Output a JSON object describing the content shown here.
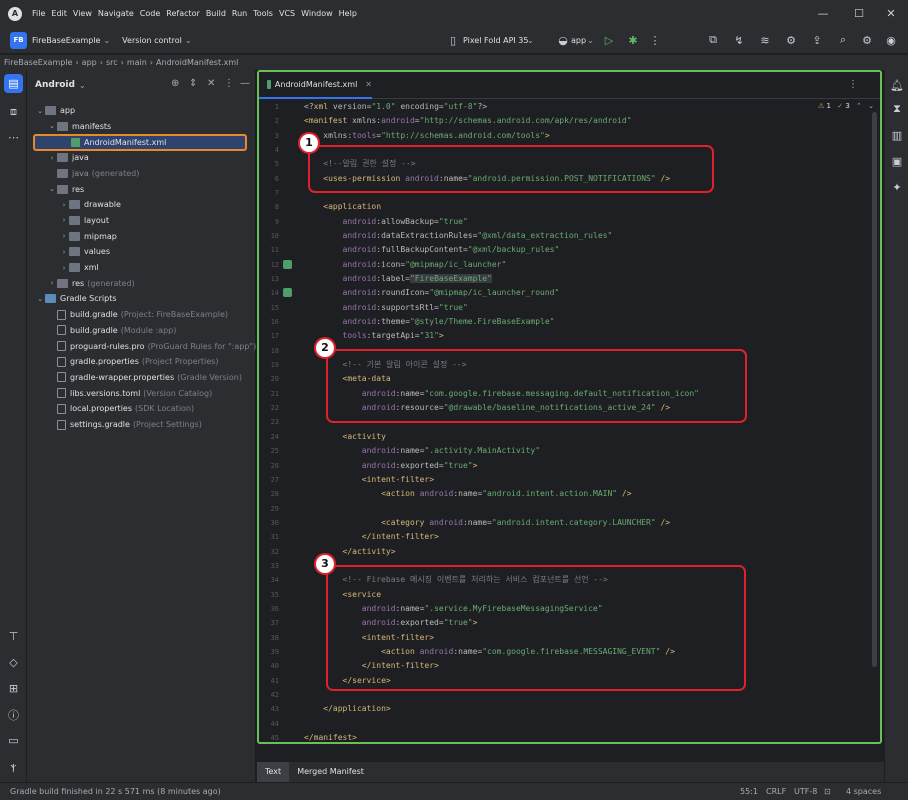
{
  "menu_bar": {
    "items": [
      "File",
      "Edit",
      "View",
      "Navigate",
      "Code",
      "Refactor",
      "Build",
      "Run",
      "Tools",
      "VCS",
      "Window",
      "Help"
    ]
  },
  "toolbar": {
    "project_badge": "FB",
    "project_name": "FireBaseExample",
    "version_control": "Version control",
    "device": "Pixel Fold API 35",
    "run_config": "app"
  },
  "breadcrumb": [
    "FireBaseExample",
    "app",
    "src",
    "main",
    "AndroidManifest.xml"
  ],
  "project_panel": {
    "view_title": "Android",
    "tree": [
      {
        "label": "app",
        "depth": 0,
        "arrow": "down",
        "icon": "folder"
      },
      {
        "label": "manifests",
        "depth": 1,
        "arrow": "down",
        "icon": "folder"
      },
      {
        "label": "AndroidManifest.xml",
        "depth": 2,
        "arrow": "",
        "icon": "manifest",
        "selected": true
      },
      {
        "label": "java",
        "depth": 1,
        "arrow": "right",
        "icon": "folder"
      },
      {
        "label": "java",
        "sub": "(generated)",
        "depth": 1,
        "arrow": "",
        "icon": "folder",
        "dim": true
      },
      {
        "label": "res",
        "depth": 1,
        "arrow": "down",
        "icon": "folder"
      },
      {
        "label": "drawable",
        "depth": 2,
        "arrow": "right",
        "icon": "folder"
      },
      {
        "label": "layout",
        "depth": 2,
        "arrow": "right",
        "icon": "folder"
      },
      {
        "label": "mipmap",
        "depth": 2,
        "arrow": "right",
        "icon": "folder"
      },
      {
        "label": "values",
        "depth": 2,
        "arrow": "right",
        "icon": "folder"
      },
      {
        "label": "xml",
        "depth": 2,
        "arrow": "right",
        "icon": "folder"
      },
      {
        "label": "res",
        "sub": "(generated)",
        "depth": 1,
        "arrow": "right",
        "icon": "folder"
      },
      {
        "label": "Gradle Scripts",
        "depth": 0,
        "arrow": "down",
        "icon": "gradle"
      },
      {
        "label": "build.gradle",
        "sub": "(Project: FireBaseExample)",
        "depth": 1,
        "arrow": "",
        "icon": "file"
      },
      {
        "label": "build.gradle",
        "sub": "(Module :app)",
        "depth": 1,
        "arrow": "",
        "icon": "file"
      },
      {
        "label": "proguard-rules.pro",
        "sub": "(ProGuard Rules for \":app\")",
        "depth": 1,
        "arrow": "",
        "icon": "file"
      },
      {
        "label": "gradle.properties",
        "sub": "(Project Properties)",
        "depth": 1,
        "arrow": "",
        "icon": "file"
      },
      {
        "label": "gradle-wrapper.properties",
        "sub": "(Gradle Version)",
        "depth": 1,
        "arrow": "",
        "icon": "file"
      },
      {
        "label": "libs.versions.toml",
        "sub": "(Version Catalog)",
        "depth": 1,
        "arrow": "",
        "icon": "file"
      },
      {
        "label": "local.properties",
        "sub": "(SDK Location)",
        "depth": 1,
        "arrow": "",
        "icon": "file"
      },
      {
        "label": "settings.gradle",
        "sub": "(Project Settings)",
        "depth": 1,
        "arrow": "",
        "icon": "file"
      }
    ]
  },
  "editor": {
    "tab_label": "AndroidManifest.xml",
    "inspection": {
      "warnings": "1",
      "checks": "3"
    },
    "lines": [
      {
        "n": "1",
        "t": [
          [
            "p",
            "<?"
          ],
          [
            "tag",
            "xml "
          ],
          [
            "attr",
            "version"
          ],
          [
            "p",
            "="
          ],
          [
            "val",
            "\"1.0\" "
          ],
          [
            "attr",
            "encoding"
          ],
          [
            "p",
            "="
          ],
          [
            "val",
            "\"utf-8\""
          ],
          [
            "p",
            "?>"
          ]
        ]
      },
      {
        "n": "2",
        "t": [
          [
            "tag",
            "<manifest "
          ],
          [
            "attr",
            "xmlns:"
          ],
          [
            "ns",
            "android"
          ],
          [
            "p",
            "="
          ],
          [
            "val",
            "\"http://schemas.android.com/apk/res/android\""
          ]
        ]
      },
      {
        "n": "3",
        "t": [
          [
            "p",
            "    "
          ],
          [
            "attr",
            "xmlns:"
          ],
          [
            "ns",
            "tools"
          ],
          [
            "p",
            "="
          ],
          [
            "val",
            "\"http://schemas.android.com/tools\""
          ],
          [
            "tag",
            ">"
          ]
        ]
      },
      {
        "n": "4",
        "t": []
      },
      {
        "n": "5",
        "t": [
          [
            "cm",
            "    <!--알림 권한 설정 -->"
          ]
        ]
      },
      {
        "n": "6",
        "t": [
          [
            "tag",
            "    <uses-permission "
          ],
          [
            "ns",
            "android"
          ],
          [
            "attr",
            ":name"
          ],
          [
            "p",
            "="
          ],
          [
            "val",
            "\"android.permission.POST_NOTIFICATIONS\" "
          ],
          [
            "tag",
            "/>"
          ]
        ]
      },
      {
        "n": "7",
        "t": []
      },
      {
        "n": "8",
        "t": [
          [
            "tag",
            "    <application"
          ]
        ]
      },
      {
        "n": "9",
        "t": [
          [
            "ns",
            "        android"
          ],
          [
            "attr",
            ":allowBackup"
          ],
          [
            "p",
            "="
          ],
          [
            "val",
            "\"true\""
          ]
        ]
      },
      {
        "n": "10",
        "t": [
          [
            "ns",
            "        android"
          ],
          [
            "attr",
            ":dataExtractionRules"
          ],
          [
            "p",
            "="
          ],
          [
            "val",
            "\"@xml/data_extraction_rules\""
          ]
        ]
      },
      {
        "n": "11",
        "t": [
          [
            "ns",
            "        android"
          ],
          [
            "attr",
            ":fullBackupContent"
          ],
          [
            "p",
            "="
          ],
          [
            "val",
            "\"@xml/backup_rules\""
          ]
        ]
      },
      {
        "n": "12",
        "t": [
          [
            "ns",
            "        android"
          ],
          [
            "attr",
            ":icon"
          ],
          [
            "p",
            "="
          ],
          [
            "val",
            "\"@mipmap/ic_launcher\""
          ]
        ],
        "gutter": true
      },
      {
        "n": "13",
        "t": [
          [
            "ns",
            "        android"
          ],
          [
            "attr",
            ":label"
          ],
          [
            "p",
            "="
          ],
          [
            "hl",
            "\"FireBaseExample\""
          ]
        ]
      },
      {
        "n": "14",
        "t": [
          [
            "ns",
            "        android"
          ],
          [
            "attr",
            ":roundIcon"
          ],
          [
            "p",
            "="
          ],
          [
            "val",
            "\"@mipmap/ic_launcher_round\""
          ]
        ],
        "gutter": true
      },
      {
        "n": "15",
        "t": [
          [
            "ns",
            "        android"
          ],
          [
            "attr",
            ":supportsRtl"
          ],
          [
            "p",
            "="
          ],
          [
            "val",
            "\"true\""
          ]
        ]
      },
      {
        "n": "16",
        "t": [
          [
            "ns",
            "        android"
          ],
          [
            "attr",
            ":theme"
          ],
          [
            "p",
            "="
          ],
          [
            "val",
            "\"@style/Theme.FireBaseExample\""
          ]
        ]
      },
      {
        "n": "17",
        "t": [
          [
            "ns",
            "        tools"
          ],
          [
            "attr",
            ":targetApi"
          ],
          [
            "p",
            "="
          ],
          [
            "val",
            "\"31\""
          ],
          [
            "tag",
            ">"
          ]
        ]
      },
      {
        "n": "18",
        "t": []
      },
      {
        "n": "19",
        "t": [
          [
            "cm",
            "        <!-- 기본 알림 아이콘 설정 -->"
          ]
        ]
      },
      {
        "n": "20",
        "t": [
          [
            "tag",
            "        <meta-data"
          ]
        ]
      },
      {
        "n": "21",
        "t": [
          [
            "ns",
            "            android"
          ],
          [
            "attr",
            ":name"
          ],
          [
            "p",
            "="
          ],
          [
            "val",
            "\"com.google.firebase.messaging.default_notification_icon\""
          ]
        ]
      },
      {
        "n": "22",
        "t": [
          [
            "ns",
            "            android"
          ],
          [
            "attr",
            ":resource"
          ],
          [
            "p",
            "="
          ],
          [
            "val",
            "\"@drawable/baseline_notifications_active_24\" "
          ],
          [
            "tag",
            "/>"
          ]
        ]
      },
      {
        "n": "23",
        "t": []
      },
      {
        "n": "24",
        "t": [
          [
            "tag",
            "        <activity"
          ]
        ]
      },
      {
        "n": "25",
        "t": [
          [
            "ns",
            "            android"
          ],
          [
            "attr",
            ":name"
          ],
          [
            "p",
            "="
          ],
          [
            "val",
            "\".activity.MainActivity\""
          ]
        ]
      },
      {
        "n": "26",
        "t": [
          [
            "ns",
            "            android"
          ],
          [
            "attr",
            ":exported"
          ],
          [
            "p",
            "="
          ],
          [
            "val",
            "\"true\""
          ],
          [
            "tag",
            ">"
          ]
        ]
      },
      {
        "n": "27",
        "t": [
          [
            "tag",
            "            <intent-filter>"
          ]
        ]
      },
      {
        "n": "28",
        "t": [
          [
            "tag",
            "                <action "
          ],
          [
            "ns",
            "android"
          ],
          [
            "attr",
            ":name"
          ],
          [
            "p",
            "="
          ],
          [
            "val",
            "\"android.intent.action.MAIN\" "
          ],
          [
            "tag",
            "/>"
          ]
        ]
      },
      {
        "n": "29",
        "t": []
      },
      {
        "n": "30",
        "t": [
          [
            "tag",
            "                <category "
          ],
          [
            "ns",
            "android"
          ],
          [
            "attr",
            ":name"
          ],
          [
            "p",
            "="
          ],
          [
            "val",
            "\"android.intent.category.LAUNCHER\" "
          ],
          [
            "tag",
            "/>"
          ]
        ]
      },
      {
        "n": "31",
        "t": [
          [
            "tag",
            "            </intent-filter>"
          ]
        ]
      },
      {
        "n": "32",
        "t": [
          [
            "tag",
            "        </activity>"
          ]
        ]
      },
      {
        "n": "33",
        "t": []
      },
      {
        "n": "34",
        "t": [
          [
            "cm",
            "        <!-- Firebase 메시징 이벤트를 처리하는 서비스 컴포넌트를 선언 -->"
          ]
        ]
      },
      {
        "n": "35",
        "t": [
          [
            "tag",
            "        <service"
          ]
        ]
      },
      {
        "n": "36",
        "t": [
          [
            "ns",
            "            android"
          ],
          [
            "attr",
            ":name"
          ],
          [
            "p",
            "="
          ],
          [
            "val",
            "\".service.MyFirebaseMessagingService\""
          ]
        ]
      },
      {
        "n": "37",
        "t": [
          [
            "ns",
            "            android"
          ],
          [
            "attr",
            ":exported"
          ],
          [
            "p",
            "="
          ],
          [
            "val",
            "\"true\""
          ],
          [
            "tag",
            ">"
          ]
        ]
      },
      {
        "n": "38",
        "t": [
          [
            "tag",
            "            <intent-filter>"
          ]
        ]
      },
      {
        "n": "39",
        "t": [
          [
            "tag",
            "                <action "
          ],
          [
            "ns",
            "android"
          ],
          [
            "attr",
            ":name"
          ],
          [
            "p",
            "="
          ],
          [
            "val",
            "\"com.google.firebase.MESSAGING_EVENT\" "
          ],
          [
            "tag",
            "/>"
          ]
        ]
      },
      {
        "n": "40",
        "t": [
          [
            "tag",
            "            </intent-filter>"
          ]
        ]
      },
      {
        "n": "41",
        "t": [
          [
            "tag",
            "        </service>"
          ]
        ]
      },
      {
        "n": "42",
        "t": []
      },
      {
        "n": "43",
        "t": [
          [
            "tag",
            "    </application>"
          ]
        ]
      },
      {
        "n": "44",
        "t": []
      },
      {
        "n": "45",
        "t": [
          [
            "tag",
            "</manifest>"
          ]
        ]
      }
    ]
  },
  "callouts": [
    "1",
    "2",
    "3"
  ],
  "bottom_tabs": [
    "Text",
    "Merged Manifest"
  ],
  "status": {
    "message": "Gradle build finished in 22 s 571 ms (8 minutes ago)",
    "position": "55:1",
    "line_sep": "CRLF",
    "encoding": "UTF-8",
    "indent": "4 spaces"
  },
  "colors": {
    "accent": "#3574f0",
    "highlight_green": "#6bbf59",
    "callout_red": "#e0202a",
    "selected_orange": "#e8892c"
  }
}
